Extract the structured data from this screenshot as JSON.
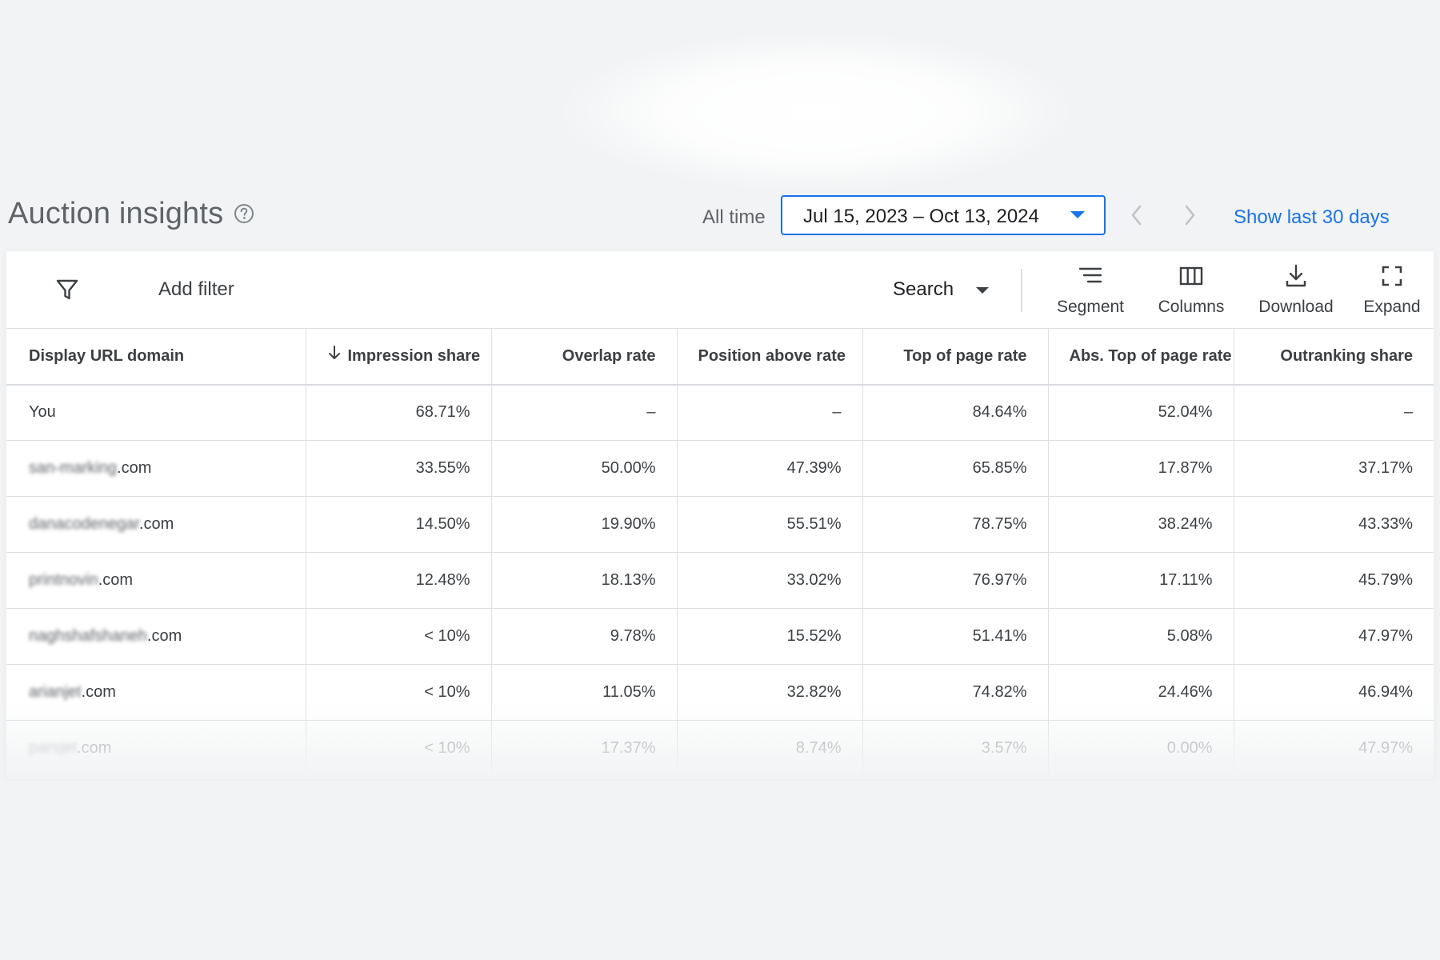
{
  "header": {
    "title": "Auction insights",
    "date_preset": "All time",
    "date_range": "Jul 15, 2023 – Oct 13, 2024",
    "show_last_label": "Show last 30 days"
  },
  "toolbar": {
    "add_filter_label": "Add filter",
    "search_dropdown_value": "Search",
    "segment_label": "Segment",
    "columns_label": "Columns",
    "download_label": "Download",
    "expand_label": "Expand"
  },
  "icons": {
    "help": "help-circle-icon",
    "filter": "filter-icon",
    "segment": "segment-lines-icon",
    "columns": "columns-icon",
    "download": "download-icon",
    "expand": "expand-corners-icon",
    "sort": "arrow-down-icon",
    "prev": "chevron-left-icon",
    "next": "chevron-right-icon"
  },
  "colors": {
    "accent": "#1a73e8",
    "title": "#5f6368",
    "background": "#f1f3f4"
  },
  "table": {
    "columns": [
      "Display URL domain",
      "Impression share",
      "Overlap rate",
      "Position above rate",
      "Top of page rate",
      "Abs. Top of page rate",
      "Outranking share"
    ],
    "sorted_column": "Impression share",
    "sort_direction": "descending",
    "rows": [
      {
        "domain_blurred": "",
        "domain_suffix": "You",
        "cells": [
          "68.71%",
          "–",
          "–",
          "84.64%",
          "52.04%",
          "–"
        ]
      },
      {
        "domain_blurred": "san-marking",
        "domain_suffix": ".com",
        "cells": [
          "33.55%",
          "50.00%",
          "47.39%",
          "65.85%",
          "17.87%",
          "37.17%"
        ]
      },
      {
        "domain_blurred": "danacodenegar",
        "domain_suffix": ".com",
        "cells": [
          "14.50%",
          "19.90%",
          "55.51%",
          "78.75%",
          "38.24%",
          "43.33%"
        ]
      },
      {
        "domain_blurred": "printnovin",
        "domain_suffix": ".com",
        "cells": [
          "12.48%",
          "18.13%",
          "33.02%",
          "76.97%",
          "17.11%",
          "45.79%"
        ]
      },
      {
        "domain_blurred": "naghshafshaneh",
        "domain_suffix": ".com",
        "cells": [
          "< 10%",
          "9.78%",
          "15.52%",
          "51.41%",
          "5.08%",
          "47.97%"
        ]
      },
      {
        "domain_blurred": "arianjet",
        "domain_suffix": ".com",
        "cells": [
          "< 10%",
          "11.05%",
          "32.82%",
          "74.82%",
          "24.46%",
          "46.94%"
        ]
      },
      {
        "domain_blurred": "parsjet",
        "domain_suffix": ".com",
        "cells": [
          "< 10%",
          "17.37%",
          "8.74%",
          "3.57%",
          "0.00%",
          "47.97%"
        ]
      }
    ]
  }
}
